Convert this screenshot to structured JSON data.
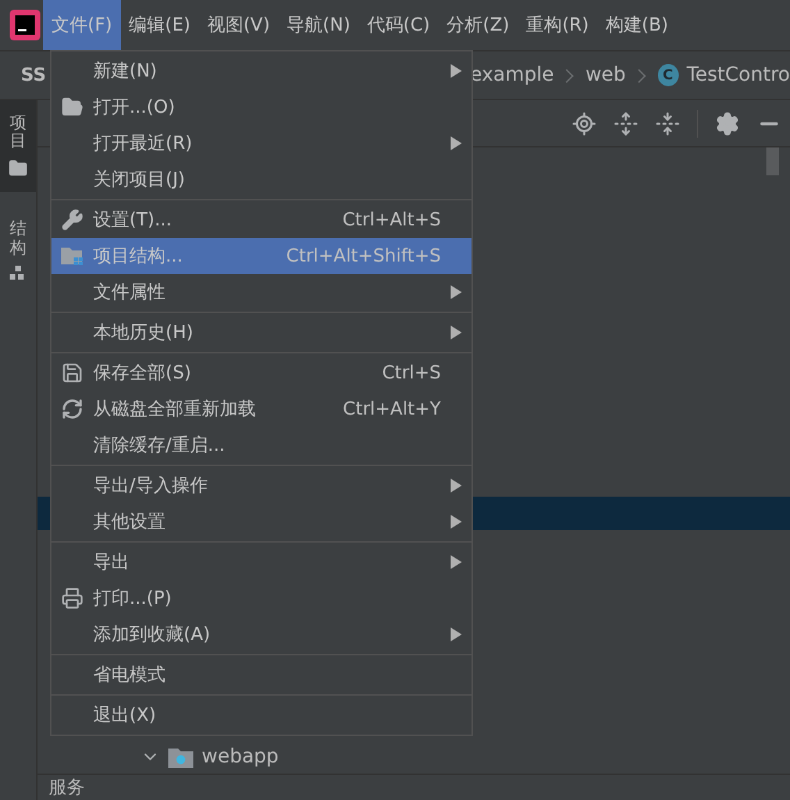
{
  "menu_bar": [
    {
      "label": "文件(F)",
      "selected": true
    },
    {
      "label": "编辑(E)",
      "selected": false
    },
    {
      "label": "视图(V)",
      "selected": false
    },
    {
      "label": "导航(N)",
      "selected": false
    },
    {
      "label": "代码(C)",
      "selected": false
    },
    {
      "label": "分析(Z)",
      "selected": false
    },
    {
      "label": "重构(R)",
      "selected": false
    },
    {
      "label": "构建(B)",
      "selected": false
    }
  ],
  "nav_bar": {
    "project": "SS",
    "breadcrumbs": [
      {
        "label": "example"
      },
      {
        "label": "web"
      },
      {
        "label": "TestContro",
        "kind": "class",
        "badge": "C"
      }
    ]
  },
  "side_tabs": [
    {
      "label": "项目",
      "selected": true,
      "kind": "folder"
    },
    {
      "label": "结构",
      "selected": false,
      "kind": "structure"
    }
  ],
  "tree": {
    "rows": [
      {
        "label": "webapp",
        "expanded": true
      }
    ]
  },
  "bottom_bar": {
    "label": "服务"
  },
  "file_menu": {
    "sections": [
      [
        {
          "label": "新建(N)",
          "submenu": true,
          "selected": false
        },
        {
          "label": "打开...(O)",
          "submenu": false,
          "selected": false,
          "kind": "open-folder"
        },
        {
          "label": "打开最近(R)",
          "submenu": true,
          "selected": false
        },
        {
          "label": "关闭项目(J)",
          "submenu": false,
          "selected": false
        }
      ],
      [
        {
          "label": "设置(T)...",
          "shortcut": "Ctrl+Alt+S",
          "submenu": false,
          "selected": false,
          "kind": "wrench"
        },
        {
          "label": "项目结构...",
          "shortcut": "Ctrl+Alt+Shift+S",
          "submenu": false,
          "selected": true,
          "kind": "structure"
        },
        {
          "label": "文件属性",
          "submenu": true,
          "selected": false
        }
      ],
      [
        {
          "label": "本地历史(H)",
          "submenu": true,
          "selected": false
        }
      ],
      [
        {
          "label": "保存全部(S)",
          "shortcut": "Ctrl+S",
          "submenu": false,
          "selected": false,
          "kind": "save"
        },
        {
          "label": "从磁盘全部重新加载",
          "shortcut": "Ctrl+Alt+Y",
          "submenu": false,
          "selected": false,
          "kind": "reload"
        },
        {
          "label": "清除缓存/重启...",
          "submenu": false,
          "selected": false
        }
      ],
      [
        {
          "label": "导出/导入操作",
          "submenu": true,
          "selected": false
        },
        {
          "label": "其他设置",
          "submenu": true,
          "selected": false
        }
      ],
      [
        {
          "label": "导出",
          "submenu": true,
          "selected": false
        },
        {
          "label": "打印...(P)",
          "submenu": false,
          "selected": false,
          "kind": "print"
        },
        {
          "label": "添加到收藏(A)",
          "submenu": true,
          "selected": false
        }
      ],
      [
        {
          "label": "省电模式",
          "submenu": false,
          "selected": false
        }
      ],
      [
        {
          "label": "退出(X)",
          "submenu": false,
          "selected": false
        }
      ]
    ]
  }
}
